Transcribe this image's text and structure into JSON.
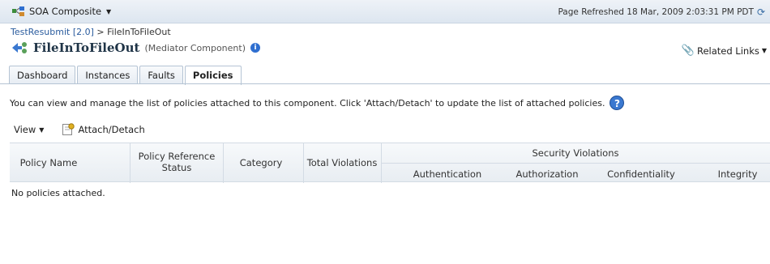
{
  "topbar": {
    "app_menu_label": "SOA Composite",
    "app_icon": "composite-app-icon",
    "refresh_text": "Page Refreshed 18 Mar, 2009 2:03:31 PM PDT",
    "refresh_icon": "refresh-icon"
  },
  "breadcrumb": {
    "parent": "TestResubmit [2.0]",
    "separator": ">",
    "current": "FileInToFileOut"
  },
  "component": {
    "icon": "mediator-component-icon",
    "title": "FileInToFileOut",
    "type": "(Mediator Component)",
    "info_icon": "info-icon"
  },
  "related_links": {
    "label": "Related Links",
    "icon": "paperclip-icon"
  },
  "tabs": [
    {
      "label": "Dashboard",
      "active": false
    },
    {
      "label": "Instances",
      "active": false
    },
    {
      "label": "Faults",
      "active": false
    },
    {
      "label": "Policies",
      "active": true
    }
  ],
  "description": "You can view and manage the list of policies attached to this component. Click 'Attach/Detach' to update the list of attached policies.",
  "help_icon": "help-icon",
  "toolbar": {
    "view_label": "View",
    "attach_label": "Attach/Detach",
    "attach_icon": "attach-detach-icon"
  },
  "table": {
    "columns": {
      "policy_name": "Policy Name",
      "ref_status": "Policy Reference Status",
      "category": "Category",
      "total_violations": "Total Violations",
      "security_group": "Security Violations",
      "authentication": "Authentication",
      "authorization": "Authorization",
      "confidentiality": "Confidentiality",
      "integrity": "Integrity"
    },
    "empty_text": "No policies attached."
  },
  "colors": {
    "link": "#2b5c9e",
    "header_bg": "#e8edf2",
    "help_blue": "#3a78d0"
  }
}
